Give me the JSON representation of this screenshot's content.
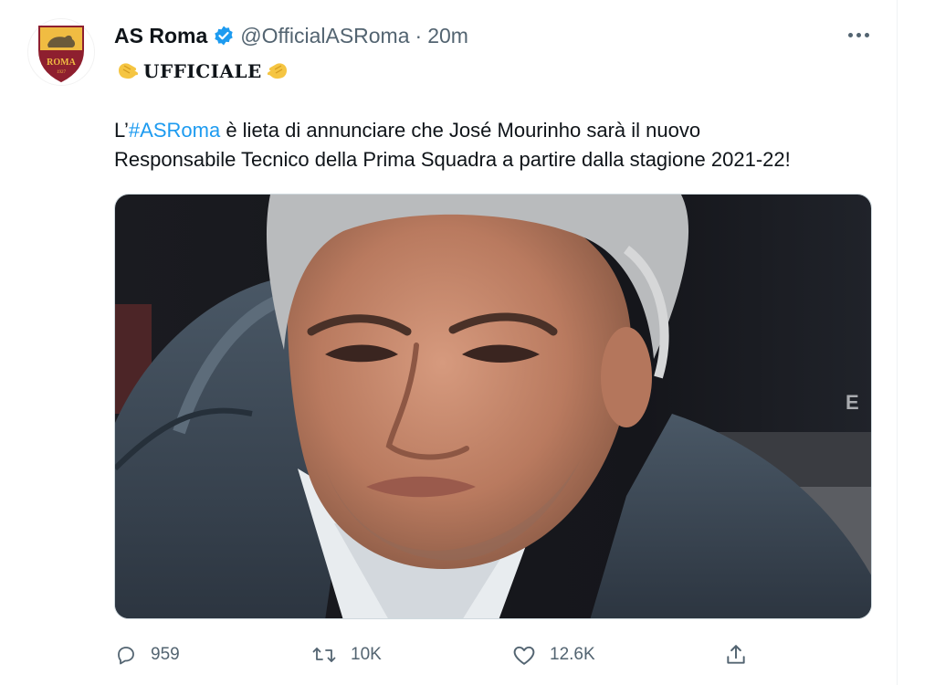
{
  "tweet": {
    "display_name": "AS Roma",
    "handle": "@OfficialASRoma",
    "separator": "·",
    "time": "20m",
    "verified": true,
    "avatar": {
      "label": "ROMA",
      "year": "1927"
    },
    "headline": {
      "prefix_emoji": "👏",
      "text": "UFFICIALE",
      "suffix_emoji": "👏"
    },
    "body": {
      "prefix": "L’",
      "hashtag": "#ASRoma",
      "line1_rest": " è lieta di annunciare che José Mourinho sarà il nuovo",
      "line2": "Responsabile Tecnico della Prima Squadra a partire dalla stagione 2021-22!"
    },
    "media": {
      "description": "Photo of José Mourinho"
    },
    "actions": {
      "replies": "959",
      "retweets": "10K",
      "likes": "12.6K"
    }
  },
  "colors": {
    "text_primary": "#0f1419",
    "text_secondary": "#536471",
    "accent": "#1d9bf0",
    "roma_red": "#8e1f2f",
    "roma_gold": "#f0bc42"
  },
  "icons": {
    "more": "more-dots-icon",
    "reply": "reply-icon",
    "retweet": "retweet-icon",
    "like": "heart-icon",
    "share": "share-icon",
    "verified": "verified-badge-icon"
  }
}
